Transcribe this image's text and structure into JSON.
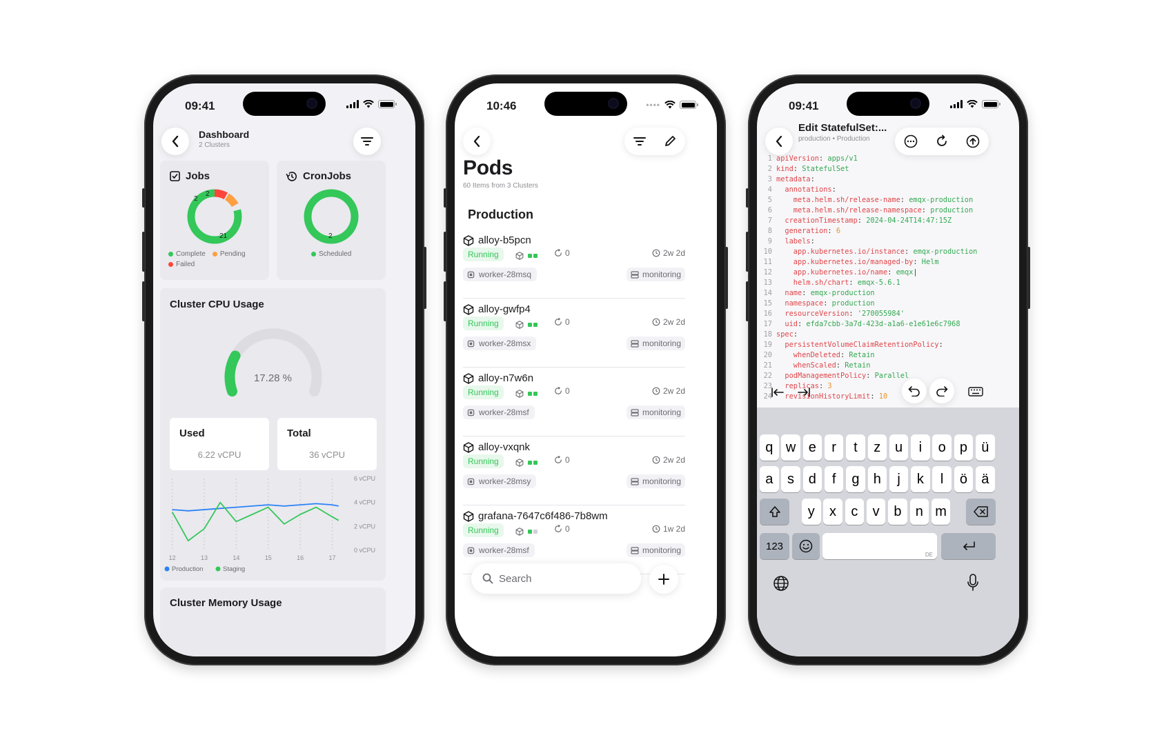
{
  "phone1": {
    "status_time": "09:41",
    "header": {
      "title": "Dashboard",
      "subtitle": "2 Clusters"
    },
    "jobs": {
      "title": "Jobs",
      "counts": {
        "complete": "21",
        "pending": "2",
        "failed": "2"
      },
      "legend": {
        "complete": "Complete",
        "pending": "Pending",
        "failed": "Failed"
      }
    },
    "cronjobs": {
      "title": "CronJobs",
      "count": "2",
      "legend": {
        "scheduled": "Scheduled"
      }
    },
    "cpu": {
      "title": "Cluster CPU Usage",
      "gauge_value": "17.28 %",
      "gauge_fraction": 0.1728,
      "used_label": "Used",
      "used_value": "6.22 vCPU",
      "total_label": "Total",
      "total_value": "36 vCPU"
    },
    "memory_title": "Cluster Memory Usage",
    "colors": {
      "green": "#34c759",
      "orange": "#ff9f40",
      "red": "#ff453a",
      "blue": "#2b82f6"
    }
  },
  "chart_data": {
    "type": "line",
    "x": [
      12,
      12.5,
      13,
      13.5,
      14,
      14.5,
      15,
      15.5,
      16,
      16.5,
      17,
      17.2
    ],
    "xticks": [
      "12",
      "13",
      "14",
      "15",
      "16",
      "17"
    ],
    "yticks": [
      "6 vCPU",
      "4 vCPU",
      "2 vCPU",
      "0 vCPU"
    ],
    "ylim": [
      0,
      6
    ],
    "series": [
      {
        "name": "Production",
        "color": "#2b82f6",
        "values": [
          3.4,
          3.3,
          3.4,
          3.5,
          3.6,
          3.7,
          3.8,
          3.7,
          3.8,
          3.9,
          3.8,
          3.7
        ]
      },
      {
        "name": "Staging",
        "color": "#34c759",
        "values": [
          3.2,
          0.8,
          1.8,
          4.0,
          2.4,
          3.0,
          3.6,
          2.2,
          3.0,
          3.6,
          2.8,
          2.5
        ]
      }
    ]
  },
  "phone2": {
    "status_time": "10:46",
    "title": "Pods",
    "subtitle": "60 Items from 3 Clusters",
    "section": "Production",
    "search_placeholder": "Search",
    "pods": [
      {
        "name": "alloy-b5pcn",
        "status": "Running",
        "ready": [
          1,
          1
        ],
        "restarts": "0",
        "age": "2w 2d",
        "node": "worker-28msq",
        "namespace": "monitoring"
      },
      {
        "name": "alloy-gwfp4",
        "status": "Running",
        "ready": [
          1,
          1
        ],
        "restarts": "0",
        "age": "2w 2d",
        "node": "worker-28msx",
        "namespace": "monitoring"
      },
      {
        "name": "alloy-n7w6n",
        "status": "Running",
        "ready": [
          1,
          1
        ],
        "restarts": "0",
        "age": "2w 2d",
        "node": "worker-28msf",
        "namespace": "monitoring"
      },
      {
        "name": "alloy-vxqnk",
        "status": "Running",
        "ready": [
          1,
          1
        ],
        "restarts": "0",
        "age": "2w 2d",
        "node": "worker-28msy",
        "namespace": "monitoring"
      },
      {
        "name": "grafana-7647c6f486-7b8wm",
        "status": "Running",
        "ready": [
          1,
          0
        ],
        "restarts": "0",
        "age": "1w 2d",
        "node": "worker-28msf",
        "namespace": "monitoring"
      }
    ]
  },
  "phone3": {
    "status_time": "09:41",
    "title": "Edit StatefulSet:...",
    "subtitle": "production • Production",
    "code": [
      [
        {
          "t": "apiVersion",
          "c": "k"
        },
        {
          "t": ": ",
          "c": "p"
        },
        {
          "t": "apps/v1",
          "c": "v"
        }
      ],
      [
        {
          "t": "kind",
          "c": "k"
        },
        {
          "t": ": ",
          "c": "p"
        },
        {
          "t": "StatefulSet",
          "c": "v"
        }
      ],
      [
        {
          "t": "metadata",
          "c": "k"
        },
        {
          "t": ":",
          "c": "p"
        }
      ],
      [
        {
          "t": "  annotations",
          "c": "k"
        },
        {
          "t": ":",
          "c": "p"
        }
      ],
      [
        {
          "t": "    meta.helm.sh/release-name",
          "c": "k"
        },
        {
          "t": ": ",
          "c": "p"
        },
        {
          "t": "emqx-production",
          "c": "v"
        }
      ],
      [
        {
          "t": "    meta.helm.sh/release-namespace",
          "c": "k"
        },
        {
          "t": ": ",
          "c": "p"
        },
        {
          "t": "production",
          "c": "v"
        }
      ],
      [
        {
          "t": "  creationTimestamp",
          "c": "k"
        },
        {
          "t": ": ",
          "c": "p"
        },
        {
          "t": "2024-04-24T14:47:15Z",
          "c": "v"
        }
      ],
      [
        {
          "t": "  generation",
          "c": "k"
        },
        {
          "t": ": ",
          "c": "p"
        },
        {
          "t": "6",
          "c": "num"
        }
      ],
      [
        {
          "t": "  labels",
          "c": "k"
        },
        {
          "t": ":",
          "c": "p"
        }
      ],
      [
        {
          "t": "    app.kubernetes.io/instance",
          "c": "k"
        },
        {
          "t": ": ",
          "c": "p"
        },
        {
          "t": "emqx-production",
          "c": "v"
        }
      ],
      [
        {
          "t": "    app.kubernetes.io/managed-by",
          "c": "k"
        },
        {
          "t": ": ",
          "c": "p"
        },
        {
          "t": "Helm",
          "c": "v"
        }
      ],
      [
        {
          "t": "    app.kubernetes.io/name",
          "c": "k"
        },
        {
          "t": ": ",
          "c": "p"
        },
        {
          "t": "emqx",
          "c": "v"
        },
        {
          "t": "|",
          "c": "p"
        }
      ],
      [
        {
          "t": "    helm.sh/chart",
          "c": "k"
        },
        {
          "t": ": ",
          "c": "p"
        },
        {
          "t": "emqx-5.6.1",
          "c": "v"
        }
      ],
      [
        {
          "t": "  name",
          "c": "k"
        },
        {
          "t": ": ",
          "c": "p"
        },
        {
          "t": "emqx-production",
          "c": "v"
        }
      ],
      [
        {
          "t": "  namespace",
          "c": "k"
        },
        {
          "t": ": ",
          "c": "p"
        },
        {
          "t": "production",
          "c": "v"
        }
      ],
      [
        {
          "t": "  resourceVersion",
          "c": "k"
        },
        {
          "t": ": ",
          "c": "p"
        },
        {
          "t": "'270055984'",
          "c": "v"
        }
      ],
      [
        {
          "t": "  uid",
          "c": "k"
        },
        {
          "t": ": ",
          "c": "p"
        },
        {
          "t": "efda7cbb-3a7d-423d-a1a6-e1e61e6c7968",
          "c": "v"
        }
      ],
      [
        {
          "t": "spec",
          "c": "k"
        },
        {
          "t": ":",
          "c": "p"
        }
      ],
      [
        {
          "t": "  persistentVolumeClaimRetentionPolicy",
          "c": "k"
        },
        {
          "t": ":",
          "c": "p"
        }
      ],
      [
        {
          "t": "    whenDeleted",
          "c": "k"
        },
        {
          "t": ": ",
          "c": "p"
        },
        {
          "t": "Retain",
          "c": "v"
        }
      ],
      [
        {
          "t": "    whenScaled",
          "c": "k"
        },
        {
          "t": ": ",
          "c": "p"
        },
        {
          "t": "Retain",
          "c": "v"
        }
      ],
      [
        {
          "t": "  podManagementPolicy",
          "c": "k"
        },
        {
          "t": ": ",
          "c": "p"
        },
        {
          "t": "Parallel",
          "c": "v"
        }
      ],
      [
        {
          "t": "  replicas",
          "c": "k"
        },
        {
          "t": ": ",
          "c": "p"
        },
        {
          "t": "3",
          "c": "num"
        }
      ],
      [
        {
          "t": "  revisionHistoryLimit",
          "c": "k"
        },
        {
          "t": ": ",
          "c": "p"
        },
        {
          "t": "10",
          "c": "num"
        }
      ]
    ],
    "keyboard": {
      "row1": [
        "q",
        "w",
        "e",
        "r",
        "t",
        "z",
        "u",
        "i",
        "o",
        "p",
        "ü"
      ],
      "row2": [
        "a",
        "s",
        "d",
        "f",
        "g",
        "h",
        "j",
        "k",
        "l",
        "ö",
        "ä"
      ],
      "row3": [
        "y",
        "x",
        "c",
        "v",
        "b",
        "n",
        "m"
      ],
      "numbers_key": "123",
      "space_hint": "DE"
    }
  }
}
